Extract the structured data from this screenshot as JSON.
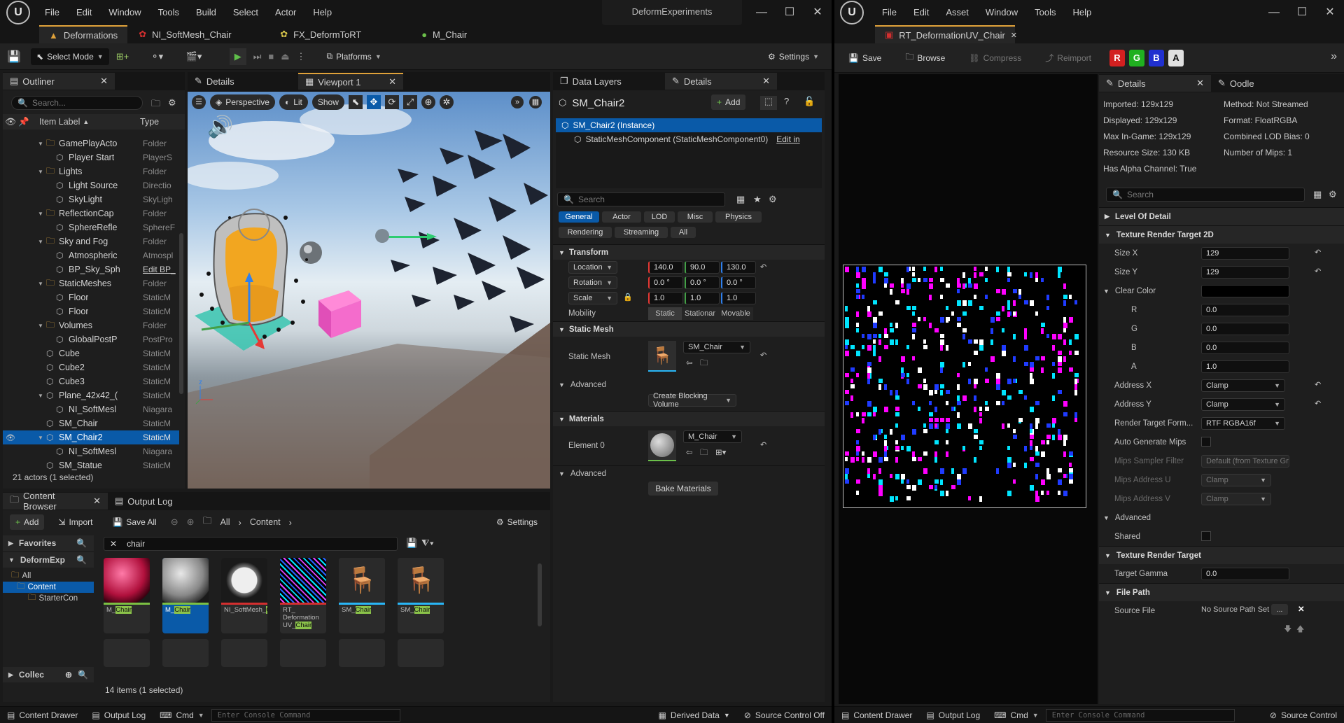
{
  "left": {
    "menu": [
      "File",
      "Edit",
      "Window",
      "Tools",
      "Build",
      "Select",
      "Actor",
      "Help"
    ],
    "project_name": "DeformExperiments",
    "tabs": [
      "Deformations",
      "NI_SoftMesh_Chair",
      "FX_DeformToRT",
      "M_Chair"
    ],
    "toolbar": {
      "select_mode": "Select Mode",
      "platforms": "Platforms",
      "settings": "Settings"
    },
    "outliner": {
      "tab": "Outliner",
      "search_placeholder": "Search...",
      "col_label": "Item Label",
      "col_type": "Type",
      "items": [
        {
          "label": "GamePlayActo",
          "type": "Folder",
          "indent": 2,
          "folder": true
        },
        {
          "label": "Player Start",
          "type": "PlayerS",
          "indent": 3
        },
        {
          "label": "Lights",
          "type": "Folder",
          "indent": 2,
          "folder": true
        },
        {
          "label": "Light Source",
          "type": "Directio",
          "indent": 3
        },
        {
          "label": "SkyLight",
          "type": "SkyLigh",
          "indent": 3
        },
        {
          "label": "ReflectionCap",
          "type": "Folder",
          "indent": 2,
          "folder": true
        },
        {
          "label": "SphereRefle",
          "type": "SphereF",
          "indent": 3
        },
        {
          "label": "Sky and Fog",
          "type": "Folder",
          "indent": 2,
          "folder": true
        },
        {
          "label": "Atmospheric",
          "type": "Atmospl",
          "indent": 3
        },
        {
          "label": "BP_Sky_Sph",
          "type": "Edit BP_",
          "indent": 3,
          "link": true
        },
        {
          "label": "StaticMeshes",
          "type": "Folder",
          "indent": 2,
          "folder": true
        },
        {
          "label": "Floor",
          "type": "StaticM",
          "indent": 3
        },
        {
          "label": "Floor",
          "type": "StaticM",
          "indent": 3
        },
        {
          "label": "Volumes",
          "type": "Folder",
          "indent": 2,
          "folder": true
        },
        {
          "label": "GlobalPostP",
          "type": "PostPro",
          "indent": 3
        },
        {
          "label": "Cube",
          "type": "StaticM",
          "indent": 2
        },
        {
          "label": "Cube2",
          "type": "StaticM",
          "indent": 2
        },
        {
          "label": "Cube3",
          "type": "StaticM",
          "indent": 2
        },
        {
          "label": "Plane_42x42_(",
          "type": "StaticM",
          "indent": 2,
          "expand": true
        },
        {
          "label": "NI_SoftMesl",
          "type": "Niagara",
          "indent": 3
        },
        {
          "label": "SM_Chair",
          "type": "StaticM",
          "indent": 2
        },
        {
          "label": "SM_Chair2",
          "type": "StaticM",
          "indent": 2,
          "selected": true,
          "expand": true
        },
        {
          "label": "NI_SoftMesl",
          "type": "Niagara",
          "indent": 3
        },
        {
          "label": "SM_Statue",
          "type": "StaticM",
          "indent": 2
        }
      ],
      "footer": "21 actors (1 selected)"
    },
    "viewport": {
      "tab_details": "Details",
      "tab": "Viewport 1",
      "perspective": "Perspective",
      "lit": "Lit",
      "show": "Show"
    },
    "details": {
      "tab_layers": "Data Layers",
      "tab": "Details",
      "actor_name": "SM_Chair2",
      "add": "Add",
      "instance": "SM_Chair2 (Instance)",
      "component": "StaticMeshComponent (StaticMeshComponent0)",
      "edit_in": "Edit in",
      "search_placeholder": "Search",
      "filters": [
        "General",
        "Actor",
        "LOD",
        "Misc",
        "Physics",
        "Rendering",
        "Streaming",
        "All"
      ],
      "transform": "Transform",
      "location": "Location",
      "rotation": "Rotation",
      "scale": "Scale",
      "loc": [
        "140.0",
        "90.0",
        "130.0"
      ],
      "rot": [
        "0.0 °",
        "0.0 °",
        "0.0 °"
      ],
      "scl": [
        "1.0",
        "1.0",
        "1.0"
      ],
      "mobility": "Mobility",
      "mob_opts": [
        "Static",
        "Stationar",
        "Movable"
      ],
      "static_mesh_sec": "Static Mesh",
      "static_mesh": "Static Mesh",
      "mesh_value": "SM_Chair",
      "advanced": "Advanced",
      "blocking": "Create Blocking Volume",
      "materials": "Materials",
      "element0": "Element 0",
      "mat_value": "M_Chair",
      "advanced2": "Advanced",
      "bake": "Bake Materials"
    },
    "content_browser": {
      "tab": "Content Browser",
      "tab_log": "Output Log",
      "add": "Add",
      "import": "Import",
      "save_all": "Save All",
      "path": [
        "All",
        "Content"
      ],
      "settings": "Settings",
      "favorites": "Favorites",
      "project": "DeformExp",
      "tree": [
        "All",
        "Content",
        "StarterCon"
      ],
      "collections": "Collec",
      "search_value": "chair",
      "assets": [
        {
          "pre": "M_",
          "hl": "Chair",
          "post": "",
          "bar": "#7bc043"
        },
        {
          "pre": "M_",
          "hl": "Chair",
          "post": "",
          "bar": "#7bc043",
          "selected": true
        },
        {
          "pre": "NI_SoftMesh_",
          "hl": "Chair",
          "post": "",
          "bar": "#d32f2f"
        },
        {
          "pre": "RT_ Deformation UV_",
          "hl": "Chair",
          "post": "",
          "bar": "#d32f2f"
        },
        {
          "pre": "SM_",
          "hl": "Chair",
          "post": "",
          "bar": "#29b6f6"
        },
        {
          "pre": "SM_",
          "hl": "Chair",
          "post": "",
          "bar": "#29b6f6"
        }
      ],
      "count": "14 items (1 selected)"
    },
    "status": {
      "drawer": "Content Drawer",
      "log": "Output Log",
      "cmd": "Cmd",
      "console": "Enter Console Command",
      "derived": "Derived Data",
      "source": "Source Control Off"
    }
  },
  "right": {
    "menu": [
      "File",
      "Edit",
      "Asset",
      "Window",
      "Tools",
      "Help"
    ],
    "tab": "RT_DeformationUV_Chair",
    "toolbar": {
      "save": "Save",
      "browse": "Browse",
      "compress": "Compress",
      "reimport": "Reimport",
      "channels": [
        "R",
        "G",
        "B",
        "A"
      ]
    },
    "details_tab": "Details",
    "oodle_tab": "Oodle",
    "info_left": [
      "Imported: 129x129",
      "Displayed: 129x129",
      "Max In-Game: 129x129",
      "Resource Size: 130 KB",
      "Has Alpha Channel: True"
    ],
    "info_right": [
      "Method: Not Streamed",
      "Format: FloatRGBA",
      "Combined LOD Bias: 0",
      "Number of Mips: 1"
    ],
    "search_placeholder": "Search",
    "lod": "Level Of Detail",
    "rt2d": "Texture Render Target 2D",
    "size_x": "Size X",
    "size_x_val": "129",
    "size_y": "Size Y",
    "size_y_val": "129",
    "clear_color": "Clear Color",
    "r": "R",
    "r_val": "0.0",
    "g": "G",
    "g_val": "0.0",
    "b": "B",
    "b_val": "0.0",
    "a": "A",
    "a_val": "1.0",
    "addr_x": "Address X",
    "addr_x_val": "Clamp",
    "addr_y": "Address Y",
    "addr_y_val": "Clamp",
    "rt_format": "Render Target Form...",
    "rt_format_val": "RTF RGBA16f",
    "auto_mips": "Auto Generate Mips",
    "mips_filter": "Mips Sampler Filter",
    "mips_filter_val": "Default (from Texture Gr",
    "mips_u": "Mips Address U",
    "mips_u_val": "Clamp",
    "mips_v": "Mips Address V",
    "mips_v_val": "Clamp",
    "advanced": "Advanced",
    "shared": "Shared",
    "rt": "Texture Render Target",
    "gamma": "Target Gamma",
    "gamma_val": "0.0",
    "filepath": "File Path",
    "source_file": "Source File",
    "source_val": "No Source Path Set",
    "status": {
      "drawer": "Content Drawer",
      "log": "Output Log",
      "cmd": "Cmd",
      "console": "Enter Console Command",
      "source": "Source Control"
    }
  },
  "colors": {
    "accent": "#e0a23a",
    "select_blue": "#0a5aa8",
    "green_play": "#4caf50"
  }
}
